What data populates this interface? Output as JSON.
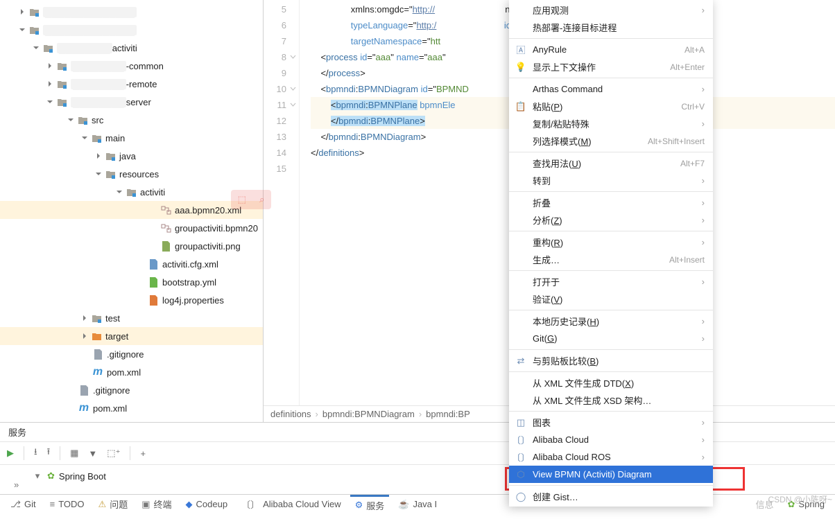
{
  "tree": {
    "rows": [
      {
        "indent": 20,
        "chev": "right",
        "icon": "folder",
        "label": "",
        "red": true
      },
      {
        "indent": 20,
        "chev": "down",
        "icon": "folder",
        "label": "",
        "red": true
      },
      {
        "indent": 40,
        "chev": "down",
        "icon": "folder",
        "label": "activiti",
        "pre": true
      },
      {
        "indent": 60,
        "chev": "right",
        "icon": "folder",
        "label": "-common",
        "pre": true
      },
      {
        "indent": 60,
        "chev": "right",
        "icon": "folder",
        "label": "-remote",
        "pre": true
      },
      {
        "indent": 60,
        "chev": "down",
        "icon": "folder",
        "label": "server",
        "pre": true
      },
      {
        "indent": 90,
        "chev": "down",
        "icon": "folder",
        "label": "src"
      },
      {
        "indent": 110,
        "chev": "down",
        "icon": "folder",
        "label": "main"
      },
      {
        "indent": 130,
        "chev": "right",
        "icon": "folder",
        "label": "java"
      },
      {
        "indent": 130,
        "chev": "down",
        "icon": "folder-res",
        "label": "resources"
      },
      {
        "indent": 160,
        "chev": "down",
        "icon": "folder",
        "label": "activiti"
      },
      {
        "indent": 210,
        "icon": "bpmn",
        "label": "aaa.bpmn20.xml",
        "sel": true
      },
      {
        "indent": 210,
        "icon": "bpmn",
        "label": "groupactiviti.bpmn20"
      },
      {
        "indent": 210,
        "icon": "png",
        "label": "groupactiviti.png"
      },
      {
        "indent": 192,
        "icon": "xml",
        "label": "activiti.cfg.xml"
      },
      {
        "indent": 192,
        "icon": "yml",
        "label": "bootstrap.yml"
      },
      {
        "indent": 192,
        "icon": "props",
        "label": "log4j.properties"
      },
      {
        "indent": 110,
        "chev": "right",
        "icon": "folder",
        "label": "test"
      },
      {
        "indent": 110,
        "chev": "right",
        "icon": "folder-tgt",
        "label": "target",
        "sel": true
      },
      {
        "indent": 112,
        "icon": "gi",
        "label": ".gitignore"
      },
      {
        "indent": 112,
        "icon": "pom",
        "label": "pom.xml"
      },
      {
        "indent": 92,
        "icon": "gi",
        "label": ".gitignore"
      },
      {
        "indent": 92,
        "icon": "pom",
        "label": "pom.xml"
      }
    ]
  },
  "editor": {
    "lines": [
      {
        "n": 5,
        "html": "                xmlns:omgdc=&quot;<span class='link'>http://</span>                            ns:omgdc=&quot;<span class='link'>http://www.</span>"
      },
      {
        "n": 6,
        "html": "                <span class='attr'>typeLanguage</span>=&quot;<span class='link'>http:/</span>                           <span class='attr'>ionLanguage</span>=&quot;<span class='link'>http://ww</span>"
      },
      {
        "n": 7,
        "html": "                <span class='attr'>targetNamespace</span>=&quot;<span class='str'>htt</span>"
      },
      {
        "n": 8,
        "html": "    &lt;<span class='tag'>process</span> <span class='attr'>id</span>=&quot;<span class='str'>aaa</span>&quot; <span class='attr'>name</span>=&quot;<span class='str'>aaa</span>&quot;"
      },
      {
        "n": 9,
        "html": "    &lt;/<span class='tag'>process</span>&gt;"
      },
      {
        "n": 10,
        "html": "    &lt;<span class='tag'>bpmndi</span>:<span class='tag'>BPMNDiagram</span> <span class='attr'>id</span>=&quot;<span class='str'>BPMND</span>"
      },
      {
        "n": 11,
        "hl": true,
        "html": "        <span class='sel-blue'>&lt;<span class='tag'>bpmndi</span>:<span class='tag'>BPMNPlane</span></span> <span class='attr'>bpmnEle</span>"
      },
      {
        "n": 12,
        "hl": true,
        "html": "        <span class='sel-blue'>&lt;/<span class='tag'>bpmndi</span>:<span class='tag'>BPMNPlane</span>&gt;</span>"
      },
      {
        "n": 13,
        "html": "    &lt;/<span class='tag'>bpmndi</span>:<span class='tag'>BPMNDiagram</span>&gt;"
      },
      {
        "n": 14,
        "html": "&lt;/<span class='tag'>definitions</span>&gt;"
      },
      {
        "n": 15,
        "html": ""
      }
    ],
    "breadcrumb": [
      "definitions",
      "bpmndi:BPMNDiagram",
      "bpmndi:BP"
    ]
  },
  "services": {
    "title": "服务",
    "spring": "Spring Boot"
  },
  "context_menu": [
    {
      "label": "应用观测",
      "arrow": true
    },
    {
      "label": "热部署-连接目标进程"
    },
    {
      "sep": true
    },
    {
      "label": "AnyRule",
      "sc": "Alt+A",
      "icon": "ar"
    },
    {
      "label": "显示上下文操作",
      "sc": "Alt+Enter",
      "icon": "bulb"
    },
    {
      "sep": true
    },
    {
      "label": "Arthas Command",
      "arrow": true
    },
    {
      "label": "粘贴(P)",
      "sc": "Ctrl+V",
      "icon": "paste",
      "u": "P"
    },
    {
      "label": "复制/粘贴特殊",
      "arrow": true
    },
    {
      "label": "列选择模式(M)",
      "sc": "Alt+Shift+Insert",
      "u": "M"
    },
    {
      "sep": true
    },
    {
      "label": "查找用法(U)",
      "sc": "Alt+F7",
      "u": "U"
    },
    {
      "label": "转到",
      "arrow": true
    },
    {
      "sep": true
    },
    {
      "label": "折叠",
      "arrow": true
    },
    {
      "label": "分析(Z)",
      "arrow": true,
      "u": "Z"
    },
    {
      "sep": true
    },
    {
      "label": "重构(R)",
      "arrow": true,
      "u": "R"
    },
    {
      "label": "生成…",
      "sc": "Alt+Insert"
    },
    {
      "sep": true
    },
    {
      "label": "打开于",
      "arrow": true
    },
    {
      "label": "验证(V)",
      "u": "V"
    },
    {
      "sep": true
    },
    {
      "label": "本地历史记录(H)",
      "arrow": true,
      "u": "H"
    },
    {
      "label": "Git(G)",
      "arrow": true,
      "u": "G"
    },
    {
      "sep": true
    },
    {
      "label": "与剪贴板比较(B)",
      "icon": "cmp",
      "u": "B"
    },
    {
      "sep": true
    },
    {
      "label": "从 XML 文件生成 DTD(X)",
      "u": "X"
    },
    {
      "label": "从 XML 文件生成 XSD 架构…"
    },
    {
      "sep": true
    },
    {
      "label": "图表",
      "arrow": true,
      "icon": "chart"
    },
    {
      "label": "Alibaba Cloud",
      "arrow": true,
      "icon": "ac"
    },
    {
      "label": "Alibaba Cloud ROS",
      "arrow": true,
      "icon": "ac"
    },
    {
      "label": "View BPMN (Activiti) Diagram",
      "sel": true,
      "icon": "bpmn"
    },
    {
      "sep": true
    },
    {
      "label": "创建 Gist…",
      "icon": "gh"
    }
  ],
  "bottom": {
    "items": [
      {
        "icon": "git",
        "label": "Git"
      },
      {
        "icon": "todo",
        "label": "TODO"
      },
      {
        "icon": "warn",
        "label": "问题"
      },
      {
        "icon": "term",
        "label": "终端"
      },
      {
        "icon": "codeup",
        "label": "Codeup"
      },
      {
        "icon": "ac",
        "label": "Alibaba Cloud View"
      },
      {
        "icon": "svc",
        "label": "服务",
        "acc": true
      },
      {
        "icon": "java",
        "label": "Java I"
      }
    ],
    "right": "Spring",
    "rt": "信息"
  },
  "watermark": "CSDN @小陈呀~"
}
